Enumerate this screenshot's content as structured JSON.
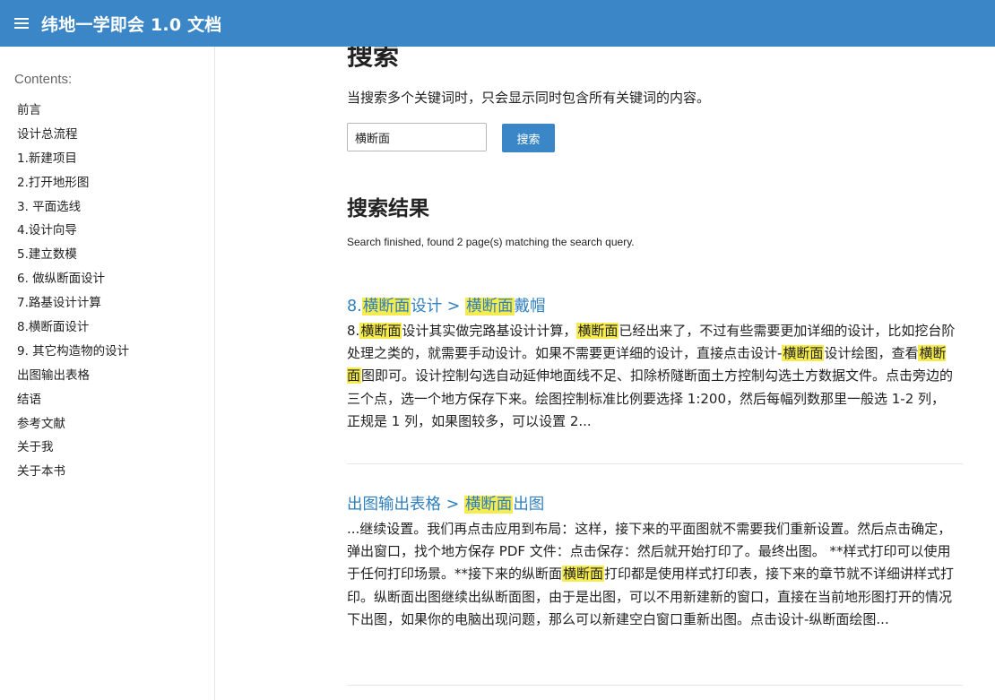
{
  "header": {
    "title": "纬地一学即会 1.0 文档",
    "menu_icon": "hamburger-menu-icon",
    "background_color": "#3b86c6"
  },
  "sidebar": {
    "caption": "Contents:",
    "items": [
      "前言",
      "设计总流程",
      "1.新建项目",
      "2.打开地形图",
      "3. 平面选线",
      "4.设计向导",
      "5.建立数模",
      "6. 做纵断面设计",
      "7.路基设计计算",
      "8.横断面设计",
      "9. 其它构造物的设计",
      "出图输出表格",
      "结语",
      "参考文献",
      "关于我",
      "关于本书"
    ]
  },
  "main": {
    "title": "搜索",
    "intro": "当搜索多个关键词时，只会显示同时包含所有关键词的内容。",
    "search": {
      "value": "横断面",
      "button_label": "搜索"
    },
    "results_heading": "搜索结果",
    "results_summary": "Search finished, found 2 page(s) matching the search query.",
    "highlight_color": "#f7ec4d",
    "link_color": "#2f7fc0",
    "results": [
      {
        "title_parts": [
          {
            "text": "8.",
            "hl": false
          },
          {
            "text": "横断面",
            "hl": true
          },
          {
            "text": "设计 ",
            "hl": false
          },
          {
            "text": ">",
            "hl": false
          },
          {
            "text": " ",
            "hl": false
          },
          {
            "text": "横断面",
            "hl": true
          },
          {
            "text": "戴帽",
            "hl": false
          }
        ],
        "snippet_parts": [
          {
            "text": "8.",
            "hl": false
          },
          {
            "text": "横断面",
            "hl": true
          },
          {
            "text": "设计其实做完路基设计计算，",
            "hl": false
          },
          {
            "text": "横断面",
            "hl": true
          },
          {
            "text": "已经出来了，不过有些需要更加详细的设计，比如挖台阶处理之类的，就需要手动设计。如果不需要更详细的设计，直接点击设计-",
            "hl": false
          },
          {
            "text": "横断面",
            "hl": true
          },
          {
            "text": "设计绘图，查看",
            "hl": false
          },
          {
            "text": "横断面",
            "hl": true
          },
          {
            "text": "图即可。设计控制勾选自动延伸地面线不足、扣除桥隧断面土方控制勾选土方数据文件。点击旁边的三个点，选一个地方保存下来。绘图控制标准比例要选择 1:200，然后每幅列数那里一般选 1-2 列，正规是 1 列，如果图较多，可以设置 2...",
            "hl": false
          }
        ]
      },
      {
        "title_parts": [
          {
            "text": "出图输出表格 ",
            "hl": false
          },
          {
            "text": ">",
            "hl": false
          },
          {
            "text": " ",
            "hl": false
          },
          {
            "text": "横断面",
            "hl": true
          },
          {
            "text": "出图",
            "hl": false
          }
        ],
        "snippet_parts": [
          {
            "text": "...继续设置。我们再点击应用到布局：这样，接下来的平面图就不需要我们重新设置。然后点击确定，弹出窗口，找个地方保存 PDF 文件：点击保存：然后就开始打印了。最终出图。 **样式打印可以使用于任何打印场景。**接下来的纵断面",
            "hl": false
          },
          {
            "text": "横断面",
            "hl": true
          },
          {
            "text": "打印都是使用样式打印表，接下来的章节就不详细讲样式打印。纵断面出图继续出纵断面图，由于是出图，可以不用新建新的窗口，直接在当前地形图打开的情况下出图，如果你的电脑出现问题，那么可以新建空白窗口重新出图。点击设计-纵断面绘图...",
            "hl": false
          }
        ]
      }
    ]
  }
}
